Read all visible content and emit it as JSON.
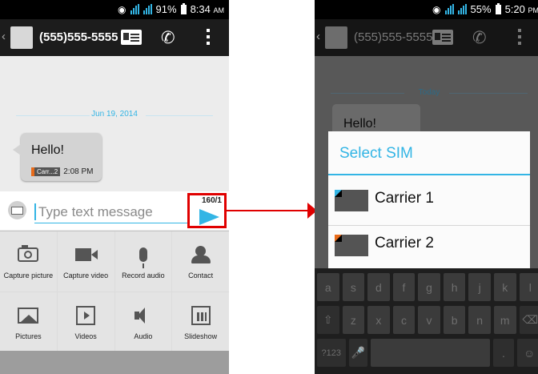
{
  "left_screen": {
    "status_bar": {
      "battery": "91%",
      "time": "8:34",
      "ampm": "AM"
    },
    "action_bar": {
      "title": "(555)555-5555"
    },
    "conversation": {
      "date_separator": "Jun 19, 2014",
      "message": {
        "text": "Hello!",
        "sim_label": "Carr...2",
        "time": "2:08 PM"
      }
    },
    "compose": {
      "placeholder": "Type text message",
      "char_counter": "160/1"
    },
    "attachments": [
      {
        "label": "Capture picture",
        "icon": "camera-icon"
      },
      {
        "label": "Capture video",
        "icon": "video-camera-icon"
      },
      {
        "label": "Record audio",
        "icon": "microphone-icon"
      },
      {
        "label": "Contact",
        "icon": "contact-icon"
      },
      {
        "label": "Pictures",
        "icon": "picture-icon"
      },
      {
        "label": "Videos",
        "icon": "video-file-icon"
      },
      {
        "label": "Audio",
        "icon": "speaker-icon"
      },
      {
        "label": "Slideshow",
        "icon": "calendar-grid-icon"
      }
    ]
  },
  "right_screen": {
    "status_bar": {
      "battery": "55%",
      "time": "5:20",
      "ampm": "PM"
    },
    "action_bar": {
      "title": "(555)555-5555"
    },
    "conversation": {
      "date_separator": "Today",
      "message": "Hello!"
    },
    "dialog": {
      "title": "Select SIM",
      "options": [
        {
          "label": "Carrier 1",
          "accent": "#33b5e5"
        },
        {
          "label": "Carrier 2",
          "accent": "#e86b1a"
        }
      ]
    },
    "keyboard": {
      "row1": [
        "a",
        "s",
        "d",
        "f",
        "g",
        "h",
        "j",
        "k",
        "l"
      ],
      "row2": [
        "⇧",
        "z",
        "x",
        "c",
        "v",
        "b",
        "n",
        "m",
        "⌫"
      ],
      "row3": [
        "?123",
        "🎤",
        "",
        ".",
        "☺"
      ]
    }
  },
  "colors": {
    "accent": "#33b5e5",
    "highlight": "#e00000"
  }
}
